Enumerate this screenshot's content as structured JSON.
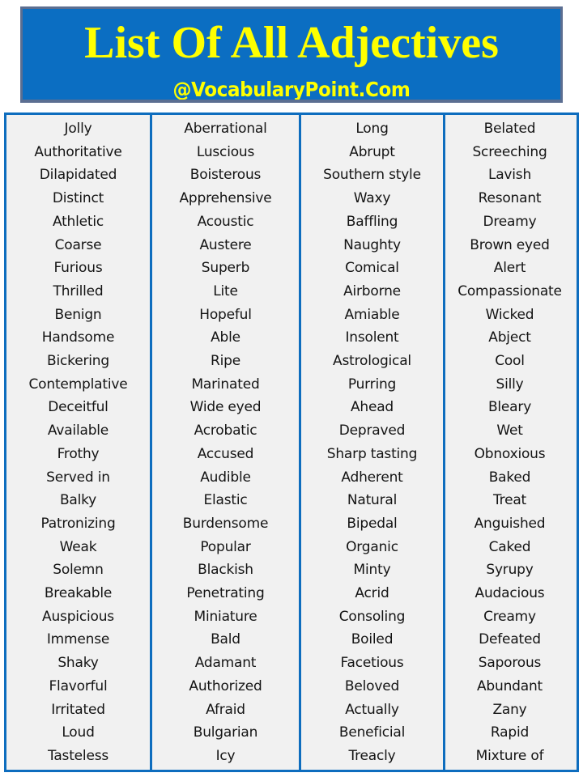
{
  "header": {
    "title": "List Of All Adjectives",
    "subtitle": "@VocabularyPoint.Com",
    "banner_color": "#0b6ec2",
    "title_color": "#ffff00"
  },
  "table": {
    "border_color": "#0e6dbe",
    "cell_background": "#f1f1f1",
    "columns": [
      {
        "index": 1,
        "words": [
          "Jolly",
          "Authoritative",
          "Dilapidated",
          "Distinct",
          "Athletic",
          "Coarse",
          "Furious",
          "Thrilled",
          "Benign",
          "Handsome",
          "Bickering",
          "Contemplative",
          "Deceitful",
          "Available",
          "Frothy",
          "Served in",
          "Balky",
          "Patronizing",
          "Weak",
          "Solemn",
          "Breakable",
          "Auspicious",
          "Immense",
          "Shaky",
          "Flavorful",
          "Irritated",
          "Loud",
          "Tasteless"
        ]
      },
      {
        "index": 2,
        "words": [
          "Aberrational",
          "Luscious",
          "Boisterous",
          "Apprehensive",
          "Acoustic",
          "Austere",
          "Superb",
          "Lite",
          "Hopeful",
          "Able",
          "Ripe",
          "Marinated",
          "Wide eyed",
          "Acrobatic",
          "Accused",
          "Audible",
          "Elastic",
          "Burdensome",
          "Popular",
          "Blackish",
          "Penetrating",
          "Miniature",
          "Bald",
          "Adamant",
          "Authorized",
          "Afraid",
          "Bulgarian",
          "Icy"
        ]
      },
      {
        "index": 3,
        "words": [
          "Long",
          "Abrupt",
          "Southern style",
          "Waxy",
          "Baffling",
          "Naughty",
          "Comical",
          "Airborne",
          "Amiable",
          "Insolent",
          "Astrological",
          "Purring",
          "Ahead",
          "Depraved",
          "Sharp tasting",
          "Adherent",
          "Natural",
          "Bipedal",
          "Organic",
          "Minty",
          "Acrid",
          "Consoling",
          "Boiled",
          "Facetious",
          "Beloved",
          "Actually",
          "Beneficial",
          "Treacly"
        ]
      },
      {
        "index": 4,
        "words": [
          "Belated",
          "Screeching",
          "Lavish",
          "Resonant",
          "Dreamy",
          "Brown eyed",
          "Alert",
          "Compassionate",
          "Wicked",
          "Abject",
          "Cool",
          "Silly",
          "Bleary",
          "Wet",
          "Obnoxious",
          "Baked",
          "Treat",
          "Anguished",
          "Caked",
          "Syrupy",
          "Audacious",
          "Creamy",
          "Defeated",
          "Saporous",
          "Abundant",
          "Zany",
          "Rapid",
          "Mixture of"
        ]
      }
    ]
  }
}
